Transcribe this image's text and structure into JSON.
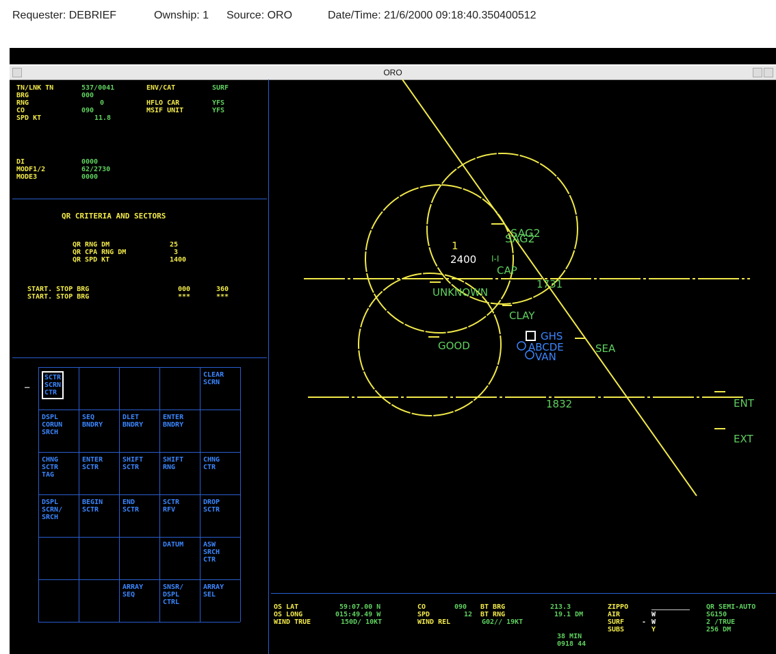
{
  "header": {
    "requester": "Requester: DEBRIEF",
    "ownship": "Ownship: 1",
    "source": "Source: ORO",
    "datetime": "Date/Time: 21/6/2000 09:18:40.350400512"
  },
  "window": {
    "title": "ORO"
  },
  "track_info": {
    "rows": [
      {
        "label": "TN/LNK TN",
        "value": "537/0041"
      },
      {
        "label": "BRG",
        "value": "000"
      },
      {
        "label": "RNG",
        "value": "0"
      },
      {
        "label": "CO",
        "value": "090"
      },
      {
        "label": "SPD KT",
        "value": "11.8"
      }
    ],
    "right_rows": [
      {
        "label": "ENV/CAT",
        "value": "SURF"
      },
      {
        "label": "HFLO CAR",
        "value": "YFS"
      },
      {
        "label": "MSIF UNIT",
        "value": "YFS"
      }
    ],
    "iff_rows": [
      {
        "label": "DI",
        "value": "0000"
      },
      {
        "label": "MODF1/2",
        "value": "62/2730"
      },
      {
        "label": "MODE3",
        "value": "0000"
      }
    ]
  },
  "qr_criteria": {
    "title": "QR CRITERIA AND SECTORS",
    "rows": [
      {
        "label": "QR RNG DM",
        "value": "25"
      },
      {
        "label": "QR CPA RNG DM",
        "value": "3"
      },
      {
        "label": "QR SPD KT",
        "value": "1400"
      }
    ],
    "sectors": [
      {
        "label": "START. STOP BRG",
        "start": "000",
        "stop": "360"
      },
      {
        "label": "START. STOP BRG",
        "start": "***",
        "stop": "***"
      }
    ]
  },
  "menu_marker": "–",
  "menu_buttons": [
    {
      "label": "SCTR\nSCRN\nCTR",
      "row": 0,
      "col": 0,
      "selected": true
    },
    {
      "label": "CLEAR\nSCRN",
      "row": 0,
      "col": 4
    },
    {
      "label": "DSPL\nCORUN\nSRCH",
      "row": 1,
      "col": 0
    },
    {
      "label": "SEQ\nBNDRY",
      "row": 1,
      "col": 1
    },
    {
      "label": "DLET\nBNDRY",
      "row": 1,
      "col": 2
    },
    {
      "label": "ENTER\nBNDRY",
      "row": 1,
      "col": 3
    },
    {
      "label": "CHNG\nSCTR\nTAG",
      "row": 2,
      "col": 0
    },
    {
      "label": "ENTER\nSCTR",
      "row": 2,
      "col": 1
    },
    {
      "label": "SHIFT\nSCTR",
      "row": 2,
      "col": 2
    },
    {
      "label": "SHIFT\nRNG",
      "row": 2,
      "col": 3
    },
    {
      "label": "CHNG\nCTR",
      "row": 2,
      "col": 4
    },
    {
      "label": "DSPL\nSCRN/\nSRCH",
      "row": 3,
      "col": 0
    },
    {
      "label": "BEGIN\nSCTR",
      "row": 3,
      "col": 1
    },
    {
      "label": "END\nSCTR",
      "row": 3,
      "col": 2
    },
    {
      "label": "SCTR\nRFV",
      "row": 3,
      "col": 3
    },
    {
      "label": "DROP\nSCTR",
      "row": 3,
      "col": 4
    },
    {
      "label": "DATUM",
      "row": 4,
      "col": 3
    },
    {
      "label": "ASW\nSRCH\nCTR",
      "row": 4,
      "col": 4
    },
    {
      "label": "ARRAY\nSEQ",
      "row": 5,
      "col": 2
    },
    {
      "label": "SNSR/\nDSPL\nCTRL",
      "row": 5,
      "col": 3
    },
    {
      "label": "ARRAY\nSEL",
      "row": 5,
      "col": 4
    }
  ],
  "radar": {
    "labels": {
      "sag2a": "SAG2",
      "sag2b": "SAG2",
      "one": "1",
      "alt": "2400",
      "ii": "I-I",
      "cap": "CAP",
      "n1731": "1731",
      "unknown": "UNKNOWN",
      "clay": "CLAY",
      "good": "GOOD",
      "ghs": "GHS",
      "sea": "SEA",
      "abcde": "ABCDE",
      "van": "VAN",
      "n1832": "1832",
      "ent": "ENT",
      "ext": "EXT"
    },
    "colors": {
      "yellow": "#f2ea4a",
      "green": "#5fd05f",
      "blue": "#3b86ff"
    }
  },
  "status": {
    "col1_labels": [
      "OS LAT",
      "OS LONG",
      "WIND TRUE"
    ],
    "col1_values": [
      "59:07.00 N",
      "015:49.49 W",
      "150D/ 10KT"
    ],
    "col2_labels": [
      "CO",
      "SPD",
      "WIND REL"
    ],
    "col2_values": [
      "090",
      "12",
      "G02// 19KT"
    ],
    "col3_labels": [
      "BT BRG",
      "BT RNG"
    ],
    "col3_values": [
      "213.3",
      "19.1 DM"
    ],
    "time_min": "38 MIN",
    "time_clock": "0918 44",
    "col4_labels": [
      "ZIPPO",
      "AIR",
      "SURF",
      "SUBS"
    ],
    "col4_values": [
      "",
      "W",
      "W",
      "Y"
    ],
    "surf_dash": "-",
    "col5": [
      "QR SEMI-AUTO",
      "SG150",
      "2 /TRUE",
      "256 DM"
    ]
  }
}
